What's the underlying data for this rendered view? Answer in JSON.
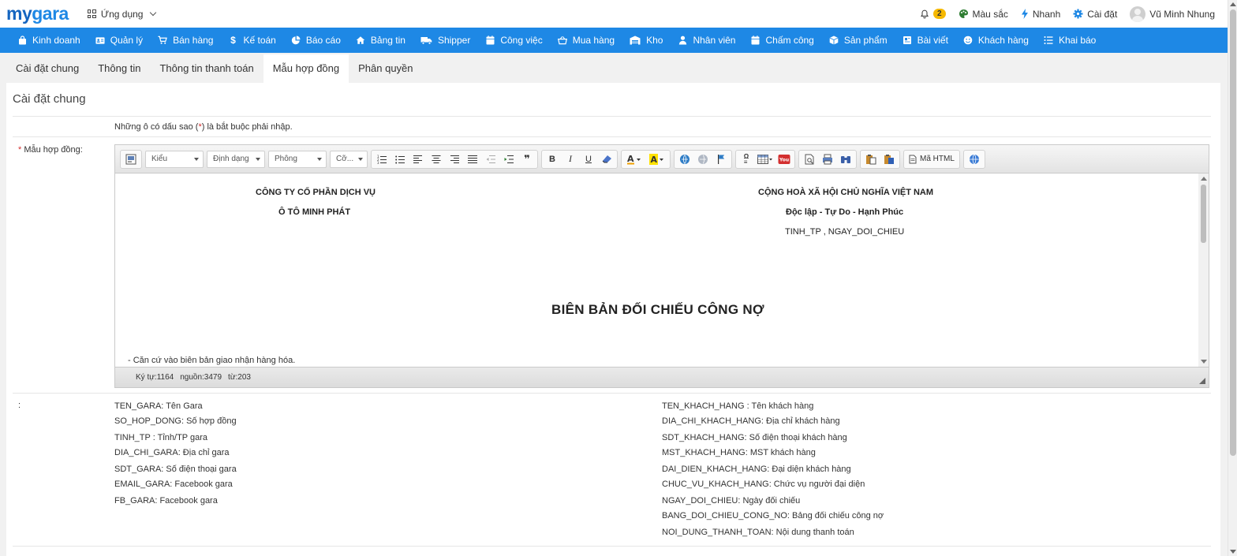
{
  "brand": {
    "logo_my": "my",
    "logo_gara": "gara"
  },
  "header": {
    "apps_label": "Ứng dụng",
    "notifications_count": "2",
    "color_label": "Màu sắc",
    "quick_label": "Nhanh",
    "settings_label": "Cài đặt",
    "user_name": "Vũ Minh Nhung"
  },
  "nav": {
    "items": [
      {
        "label": "Kinh doanh",
        "icon": "bag-icon"
      },
      {
        "label": "Quản lý",
        "icon": "id-card-icon"
      },
      {
        "label": "Bán hàng",
        "icon": "cart-icon"
      },
      {
        "label": "Kế toán",
        "icon": "dollar-icon"
      },
      {
        "label": "Báo cáo",
        "icon": "pie-chart-icon"
      },
      {
        "label": "Bảng tin",
        "icon": "home-icon"
      },
      {
        "label": "Shipper",
        "icon": "truck-icon"
      },
      {
        "label": "Công việc",
        "icon": "calendar-icon"
      },
      {
        "label": "Mua hàng",
        "icon": "basket-icon"
      },
      {
        "label": "Kho",
        "icon": "warehouse-icon"
      },
      {
        "label": "Nhân viên",
        "icon": "user-icon"
      },
      {
        "label": "Chấm công",
        "icon": "calendar-check-icon"
      },
      {
        "label": "Sản phẩm",
        "icon": "box-icon"
      },
      {
        "label": "Bài viết",
        "icon": "book-icon"
      },
      {
        "label": "Khách hàng",
        "icon": "smile-icon"
      },
      {
        "label": "Khai báo",
        "icon": "list-icon"
      }
    ]
  },
  "tabs": [
    {
      "label": "Cài đặt chung",
      "active": false
    },
    {
      "label": "Thông tin",
      "active": false
    },
    {
      "label": "Thông tin thanh toán",
      "active": false
    },
    {
      "label": "Mẫu hợp đồng",
      "active": true
    },
    {
      "label": "Phân quyền",
      "active": false
    }
  ],
  "section": {
    "title": "Cài đặt chung",
    "required_note_pre": "Những ô có dấu sao (",
    "required_note_star": "*",
    "required_note_post": ") là bắt buộc phải nhập.",
    "field_star": "*",
    "field_label": " Mẫu hợp đồng:"
  },
  "editor": {
    "style_combo": "Kiểu",
    "format_combo": "Định dạng",
    "font_combo": "Phông",
    "size_combo": "Cỡ...",
    "html_button": "Mã HTML",
    "content": {
      "left_line1": "CÔNG TY CỔ PHẦN DỊCH VỤ",
      "left_line2": "Ô TÔ MINH PHÁT",
      "right_line1": "CỘNG HOÀ XÃ HỘI CHỦ NGHĨA VIỆT NAM",
      "right_line2": "Độc lập - Tự Do - Hạnh Phúc",
      "right_line3": "TINH_TP , NGAY_DOI_CHIEU",
      "title": "BIÊN BẢN ĐỐI CHIẾU CÔNG NỢ",
      "line1": "-  Căn cứ vào biên bản giao nhận hàng hóa."
    },
    "status": {
      "chars": "Ký tự:1164",
      "source": "nguồn:3479",
      "words": "từ:203"
    }
  },
  "legend": {
    "label": ":",
    "left": [
      "TEN_GARA: Tên Gara",
      "SO_HOP_DONG: Số hợp đồng",
      "TINH_TP : Tỉnh/TP gara",
      "DIA_CHI_GARA: Địa chỉ gara",
      "SDT_GARA: Số điện thoại gara",
      "EMAIL_GARA: Facebook gara",
      "FB_GARA: Facebook gara"
    ],
    "right": [
      "TEN_KHACH_HANG : Tên khách hàng",
      "DIA_CHI_KHACH_HANG: Địa chỉ khách hàng",
      "SDT_KHACH_HANG: Số điện thoại khách hàng",
      "MST_KHACH_HANG: MST khách hàng",
      "DAI_DIEN_KHACH_HANG: Đại diện khách hàng",
      "CHUC_VU_KHACH_HANG: Chức vụ người đại diện",
      "NGAY_DOI_CHIEU: Ngày đối chiếu",
      "BANG_DOI_CHIEU_CONG_NO: Bảng đối chiếu công nợ",
      "NOI_DUNG_THANH_TOAN: Nội dung thanh toán"
    ]
  },
  "colors": {
    "nav_bg": "#1e88e5",
    "logo_dark": "#1565c0",
    "badge": "#f5b800",
    "required": "#d32f2f"
  }
}
